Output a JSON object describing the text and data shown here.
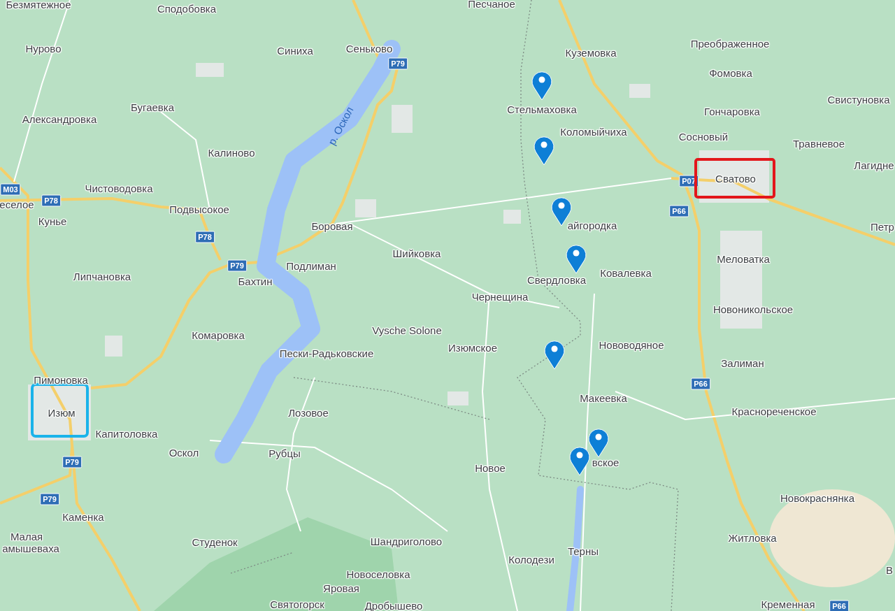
{
  "map": {
    "places": [
      {
        "label": "Безмятежное"
      },
      {
        "label": "Сподобовка"
      },
      {
        "label": "Песчаное"
      },
      {
        "label": "Нурово"
      },
      {
        "label": "Синиха"
      },
      {
        "label": "Сеньково"
      },
      {
        "label": "Куземовка"
      },
      {
        "label": "Преображенное"
      },
      {
        "label": "Фомовка"
      },
      {
        "label": "Бугаевка"
      },
      {
        "label": "Стельмаховка"
      },
      {
        "label": "Гончаровка"
      },
      {
        "label": "Свистуновка"
      },
      {
        "label": "Александровка"
      },
      {
        "label": "Коломыйчиха"
      },
      {
        "label": "Сосновый"
      },
      {
        "label": "Травневое"
      },
      {
        "label": "Калиново"
      },
      {
        "label": "Сватово"
      },
      {
        "label": "Лагидне"
      },
      {
        "label": "Чистоводовка"
      },
      {
        "label": "еселое"
      },
      {
        "label": "Подвысокое"
      },
      {
        "label": "Кунье"
      },
      {
        "label": "Боровая"
      },
      {
        "label": "айгородка"
      },
      {
        "label": "Петр"
      },
      {
        "label": "Шийковка"
      },
      {
        "label": "Меловатка"
      },
      {
        "label": "Подлиман"
      },
      {
        "label": "Липчановка"
      },
      {
        "label": "Бахтин"
      },
      {
        "label": "Ковалевка"
      },
      {
        "label": "Свердловка"
      },
      {
        "label": "Чернещина"
      },
      {
        "label": "Новоникольское"
      },
      {
        "label": "Vysche Solone"
      },
      {
        "label": "Комаровка"
      },
      {
        "label": "Изюмское"
      },
      {
        "label": "Пески-Радьковские"
      },
      {
        "label": "Нововодяное"
      },
      {
        "label": "Залиман"
      },
      {
        "label": "Пимоновка"
      },
      {
        "label": "Изюм"
      },
      {
        "label": "Лозовое"
      },
      {
        "label": "Макеевка"
      },
      {
        "label": "Краснореченское"
      },
      {
        "label": "Капитоловка"
      },
      {
        "label": "Оскол"
      },
      {
        "label": "Рубцы"
      },
      {
        "label": "вское"
      },
      {
        "label": "Новое"
      },
      {
        "label": "Новокраснянка"
      },
      {
        "label": "Каменка"
      },
      {
        "label": "Малая"
      },
      {
        "label": "амышеваха"
      },
      {
        "label": "Студенок"
      },
      {
        "label": "Шандриголово"
      },
      {
        "label": "Житловка"
      },
      {
        "label": "Колодези"
      },
      {
        "label": "Терны"
      },
      {
        "label": "Новоселовка"
      },
      {
        "label": "Яровая"
      },
      {
        "label": "Святогорск"
      },
      {
        "label": "Дробышево"
      },
      {
        "label": "Кременная"
      },
      {
        "label": "В"
      }
    ],
    "road_shields": [
      "P79",
      "M03",
      "P78",
      "P78",
      "P79",
      "P07",
      "P66",
      "P66",
      "P79",
      "P79",
      "P66"
    ],
    "river_label": "р. Оскол",
    "highlights": [
      {
        "color": "#1ab3ea"
      },
      {
        "color": "#e3161b"
      }
    ]
  }
}
